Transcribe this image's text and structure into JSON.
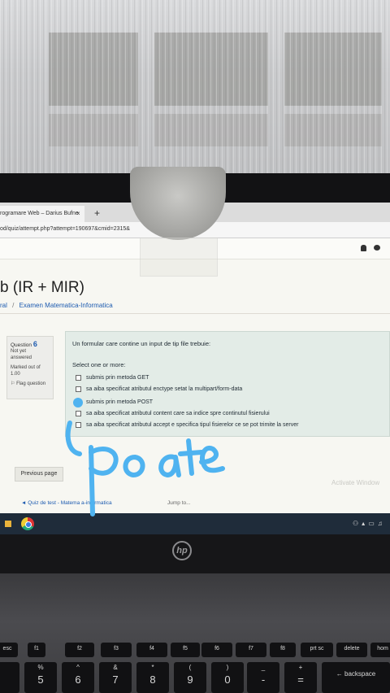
{
  "browser": {
    "tab_title": "rogramare Web – Darius Bufne",
    "tab_close": "×",
    "new_tab": "+",
    "url": "od/quiz/attempt.php?attempt=190697&cmid=2315&"
  },
  "page": {
    "course_title": "b (IR + MIR)",
    "breadcrumb": {
      "first": "ral",
      "separator": "/",
      "current": "Examen Matematica-Informatica"
    },
    "question_info": {
      "label": "Question",
      "number": "6",
      "status_line1": "Not yet",
      "status_line2": "answered",
      "marks_line1": "Marked out of",
      "marks_line2": "1.00",
      "flag": "Flag question"
    },
    "question": {
      "text": "Un formular care contine un input de tip file trebuie:",
      "prompt": "Select one or more:",
      "options": [
        "submis prin metoda GET",
        "sa aiba specificat atributul enctype setat la multipart/form-data",
        "submis prin metoda POST",
        "sa aiba specificat atributul content care sa indice spre continutul fisierului",
        "sa aiba specificat atributul accept      e specifica tipul fisierelor ce se pot trimite la server"
      ]
    },
    "previous_page": "Previous page",
    "quiz_link": "◄ Quiz de test - Matema   a-informatica",
    "jump_to": "Jump to...",
    "watermark": "Activate Window"
  },
  "keyboard": {
    "fn_row": [
      "esc",
      "f1",
      "f2",
      "f3",
      "f4",
      "f5",
      "f6",
      "f7",
      "f8",
      "f9",
      "f10",
      "prt sc",
      "delete",
      "hom"
    ],
    "number_row": [
      {
        "top": "%",
        "bot": "5"
      },
      {
        "top": "^",
        "bot": "6"
      },
      {
        "top": "&",
        "bot": "7"
      },
      {
        "top": "*",
        "bot": "8"
      },
      {
        "top": "(",
        "bot": "9"
      },
      {
        "top": ")",
        "bot": "0"
      },
      {
        "top": "_",
        "bot": "-"
      },
      {
        "top": "+",
        "bot": "="
      }
    ],
    "backspace": "← backspace"
  },
  "laptop": {
    "brand": "hp"
  },
  "handwriting": {
    "text": "poate",
    "color": "#4fb3f0"
  },
  "colors": {
    "accent_link": "#1d5bb0",
    "question_bg": "#e3ece7",
    "taskbar": "#1f2c3a"
  }
}
